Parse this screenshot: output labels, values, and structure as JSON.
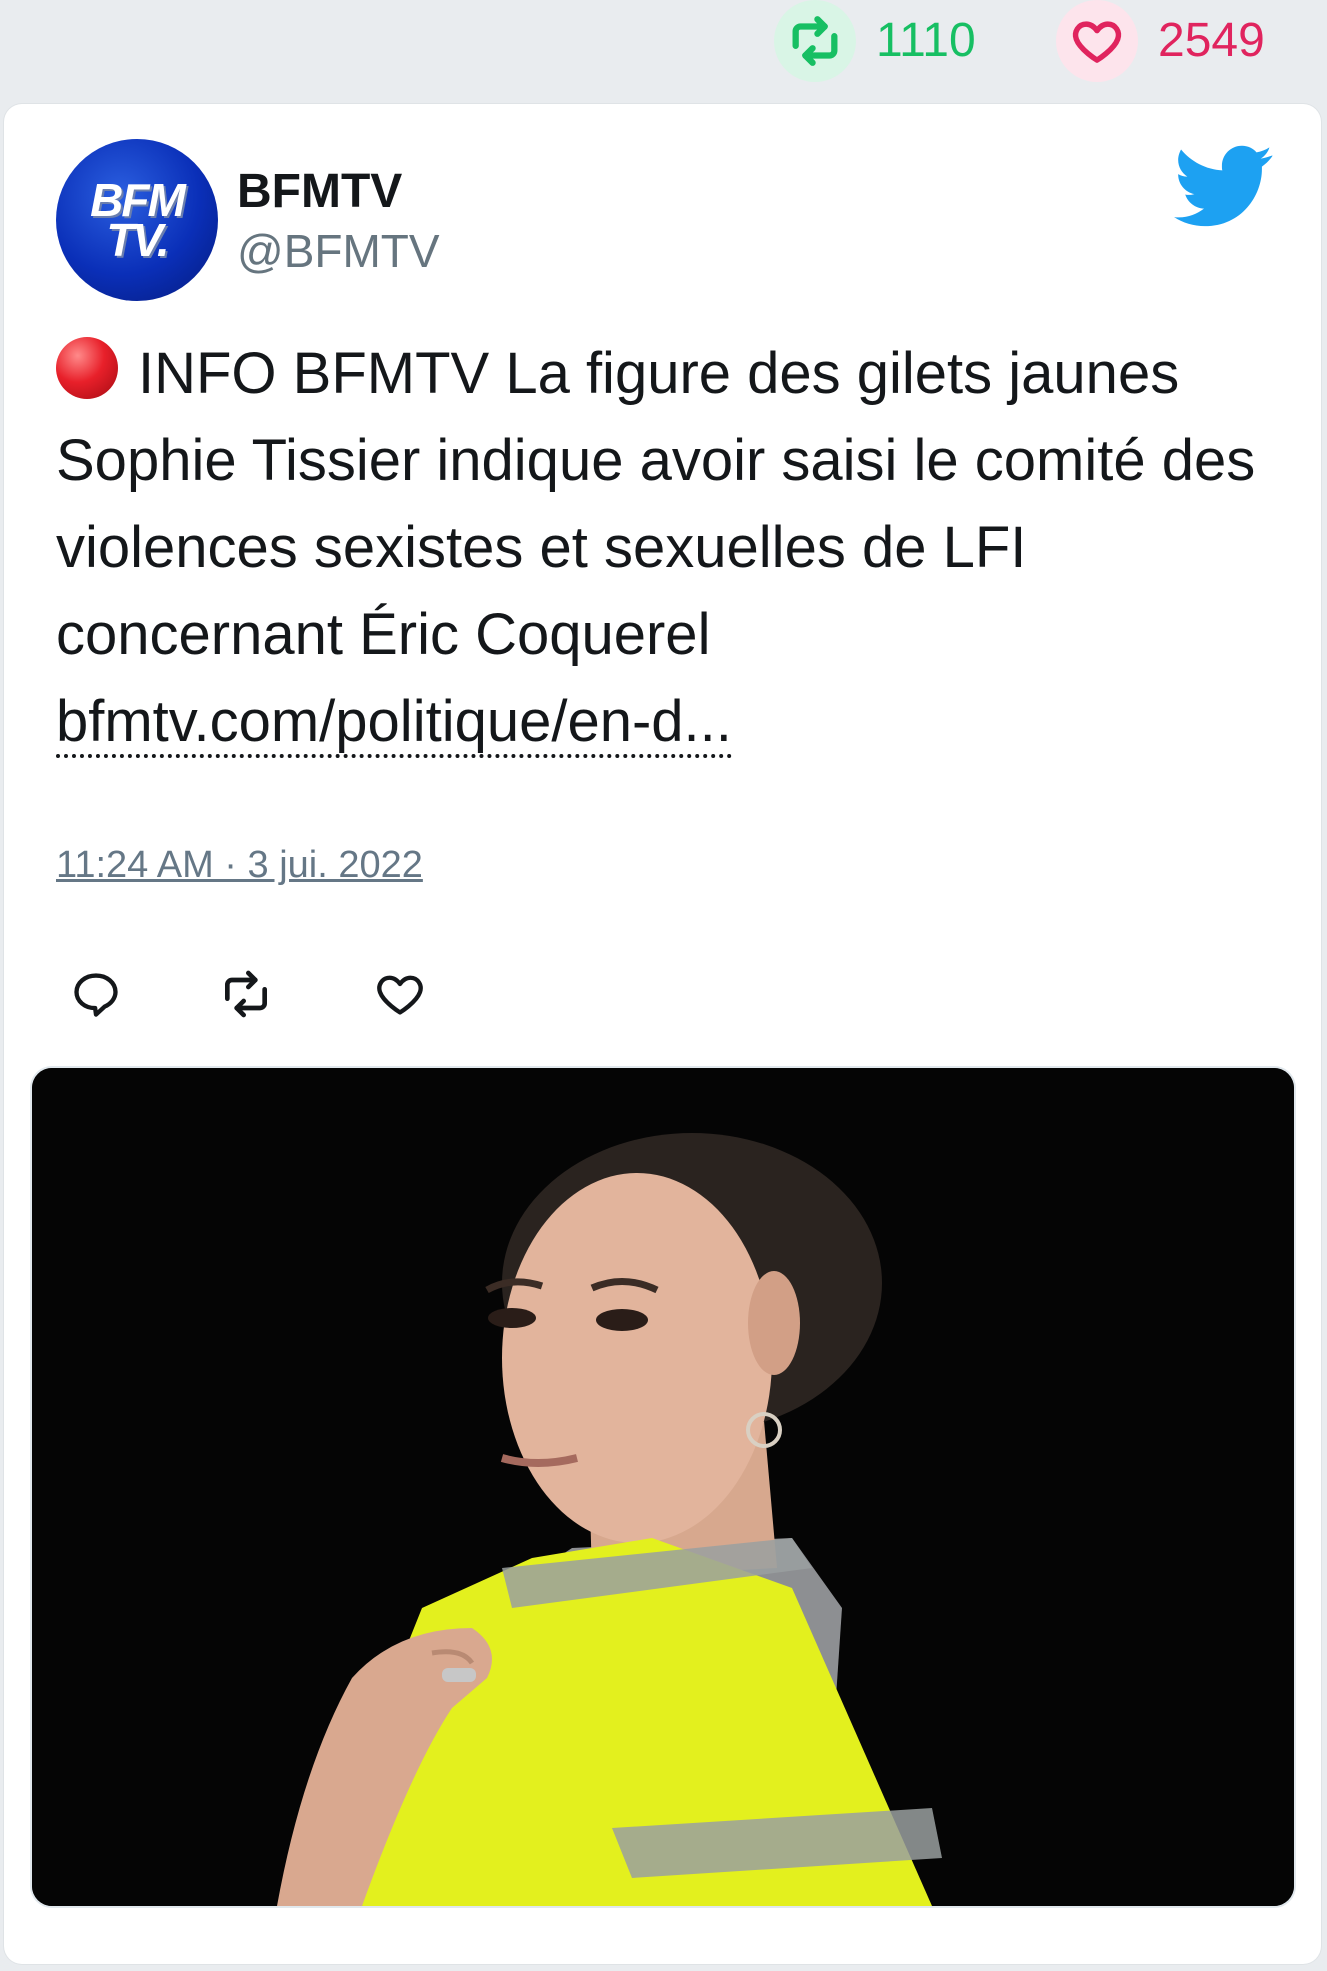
{
  "stats": {
    "retweet_icon": "retweet-icon",
    "retweet_count": "1110",
    "like_icon": "heart-icon",
    "like_count": "2549"
  },
  "tweet": {
    "avatar_line1": "BFM",
    "avatar_line2": "TV.",
    "account_name": "BFMTV",
    "account_handle": "@BFMTV",
    "brand_icon": "twitter-bird-icon",
    "live_icon": "red-circle-icon",
    "text": "INFO BFMTV La figure des gilets jaunes Sophie Tissier indique avoir saisi le comité des violences sexistes et sexuelles de LFI concernant Éric Coquerel",
    "link_text": "bfmtv.com/politique/en-d...",
    "timestamp": "11:24 AM · 3 jui. 2022",
    "actions": [
      "reply-icon",
      "retweet-icon",
      "like-icon"
    ]
  },
  "colors": {
    "retweet_green": "#17bf63",
    "like_red": "#e0245e",
    "twitter_blue": "#1da1f2",
    "vest_yellow": "#e6f21c"
  }
}
